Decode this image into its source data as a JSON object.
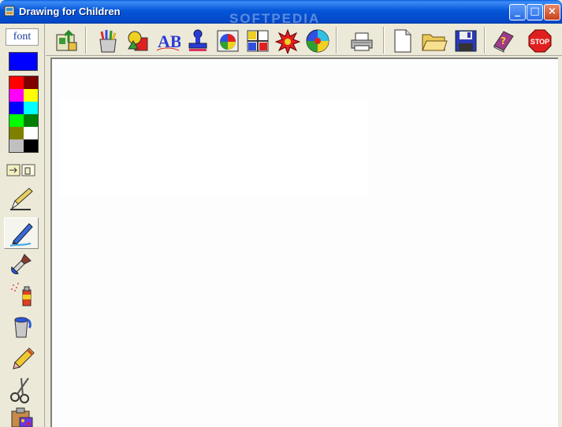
{
  "window": {
    "title": "Drawing for Children",
    "watermark": "SOFTPEDIA",
    "minimize": "_",
    "maximize": "□",
    "close": "×"
  },
  "left_panel": {
    "font_label": "font",
    "current_color": "#0000ff",
    "palette": [
      "#ff0000",
      "#800000",
      "#ff00ff",
      "#ffff00",
      "#0000ff",
      "#00ffff",
      "#00ff00",
      "#008000",
      "#808000",
      "#ffffff",
      "#c0c0c0",
      "#000000"
    ],
    "tools": [
      "hand-pointer-icon",
      "pen-icon",
      "brush-icon",
      "paint-brush-icon",
      "spray-can-icon",
      "paint-bucket-icon",
      "crayon-icon",
      "scissors-icon",
      "clipboard-icon"
    ],
    "selected_tool": "brush-icon"
  },
  "toolbar": {
    "icons": [
      "export-icon",
      "crayons-jar-icon",
      "shapes-icon",
      "abc-letters-icon",
      "stamp-icon",
      "color-wheel-icon",
      "grid-icon",
      "star-burst-icon",
      "spiral-icon",
      "printer-icon",
      "new-page-icon",
      "open-folder-icon",
      "save-disk-icon",
      "help-book-icon",
      "stop-icon"
    ],
    "help_symbol": "?",
    "stop_label": "STOP",
    "abc_label": "AB"
  }
}
